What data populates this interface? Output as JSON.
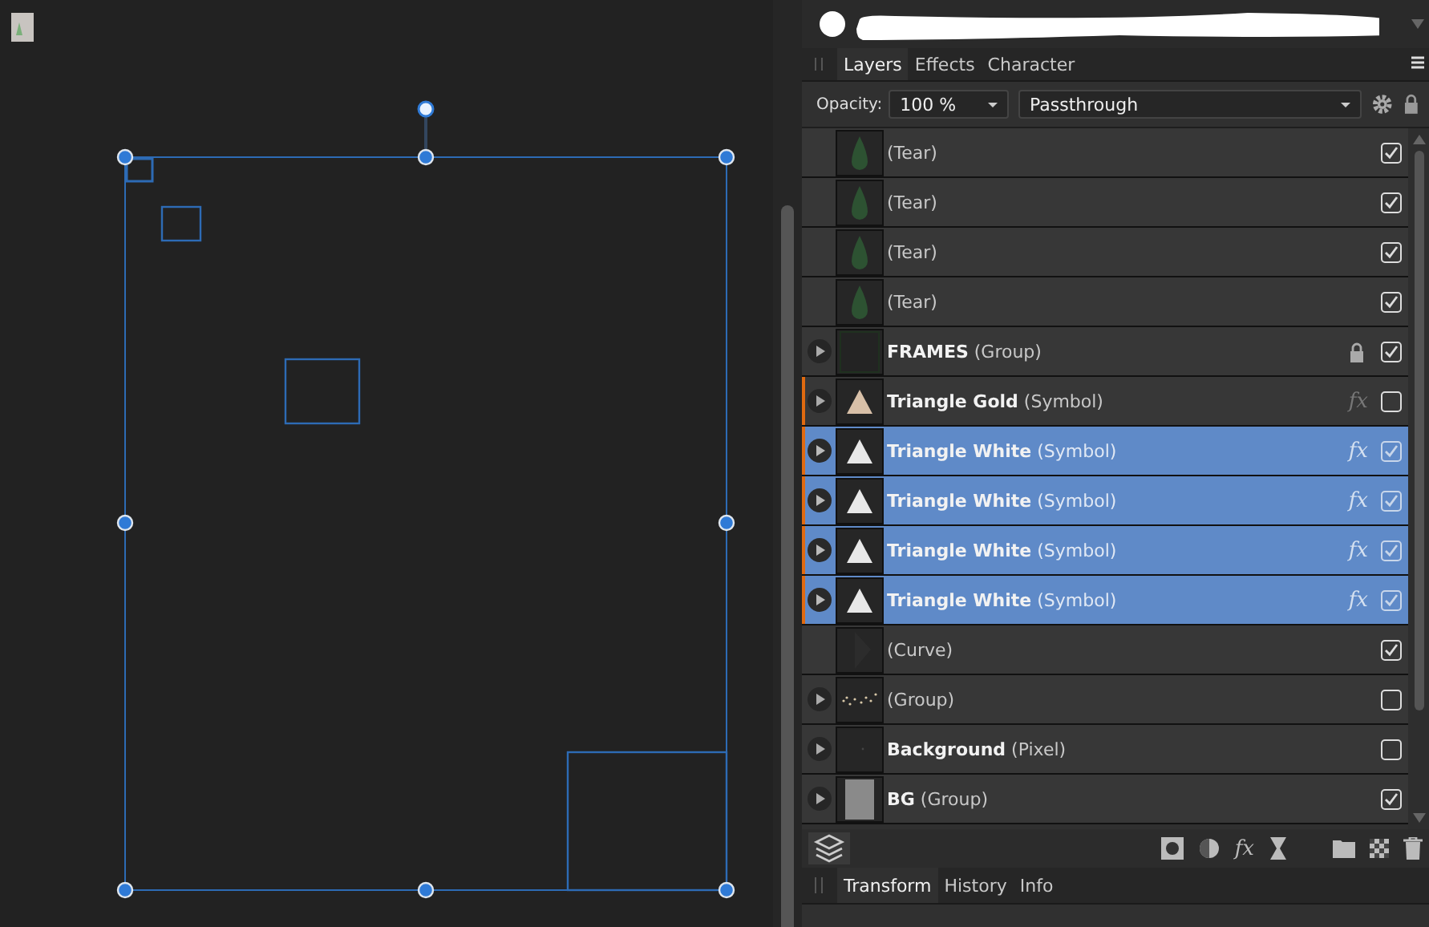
{
  "panel_tabs": [
    {
      "label": "Layers",
      "selected": true
    },
    {
      "label": "Effects",
      "selected": false
    },
    {
      "label": "Character",
      "selected": false
    }
  ],
  "opacity": {
    "label": "Opacity:",
    "value": "100 %"
  },
  "blend_mode": {
    "value": "Passthrough"
  },
  "layers": [
    {
      "kind": "tear",
      "label": "(Tear)",
      "expandable": false,
      "selected": false,
      "marked": false,
      "fx": false,
      "locked": false,
      "visible": true
    },
    {
      "kind": "tear",
      "label": "(Tear)",
      "expandable": false,
      "selected": false,
      "marked": false,
      "fx": false,
      "locked": false,
      "visible": true
    },
    {
      "kind": "tear",
      "label": "(Tear)",
      "expandable": false,
      "selected": false,
      "marked": false,
      "fx": false,
      "locked": false,
      "visible": true
    },
    {
      "kind": "tear",
      "label": "(Tear)",
      "expandable": false,
      "selected": false,
      "marked": false,
      "fx": false,
      "locked": false,
      "visible": true
    },
    {
      "kind": "frames",
      "label": "**FRAMES** (Group)",
      "expandable": true,
      "selected": false,
      "marked": false,
      "fx": false,
      "locked": true,
      "visible": true
    },
    {
      "kind": "symbol",
      "color": "#d8c0a8",
      "label": "**Triangle Gold** (Symbol)",
      "expandable": true,
      "selected": false,
      "marked": true,
      "fx": "fx",
      "locked": false,
      "visible": false
    },
    {
      "kind": "symbol",
      "color": "#e8e8e8",
      "label": "**Triangle White** (Symbol)",
      "expandable": true,
      "selected": true,
      "marked": true,
      "fx": "fx",
      "locked": false,
      "visible": true
    },
    {
      "kind": "symbol",
      "color": "#e8e8e8",
      "label": "**Triangle White** (Symbol)",
      "expandable": true,
      "selected": true,
      "marked": true,
      "fx": "fx",
      "locked": false,
      "visible": true
    },
    {
      "kind": "symbol",
      "color": "#e8e8e8",
      "label": "**Triangle White** (Symbol)",
      "expandable": true,
      "selected": true,
      "marked": true,
      "fx": "fx",
      "locked": false,
      "visible": true
    },
    {
      "kind": "symbol",
      "color": "#e8e8e8",
      "label": "**Triangle White** (Symbol)",
      "expandable": true,
      "selected": true,
      "marked": true,
      "fx": "fx",
      "locked": false,
      "visible": true
    },
    {
      "kind": "curve",
      "label": "(Curve)",
      "expandable": false,
      "selected": false,
      "marked": false,
      "fx": false,
      "locked": false,
      "visible": true
    },
    {
      "kind": "scatter",
      "label": "(Group)",
      "expandable": true,
      "selected": false,
      "marked": false,
      "fx": false,
      "locked": false,
      "visible": false
    },
    {
      "kind": "pixel",
      "label": "**Background** (Pixel)",
      "expandable": true,
      "selected": false,
      "marked": false,
      "fx": false,
      "locked": false,
      "visible": false
    },
    {
      "kind": "pattern",
      "label": "**BG** (Group)",
      "expandable": true,
      "selected": false,
      "marked": false,
      "fx": false,
      "locked": false,
      "visible": true
    }
  ],
  "toolbar": {
    "effects": "fx"
  },
  "bottom_tabs": [
    {
      "label": "Transform",
      "selected": true
    },
    {
      "label": "History",
      "selected": false
    },
    {
      "label": "Info",
      "selected": false
    }
  ]
}
